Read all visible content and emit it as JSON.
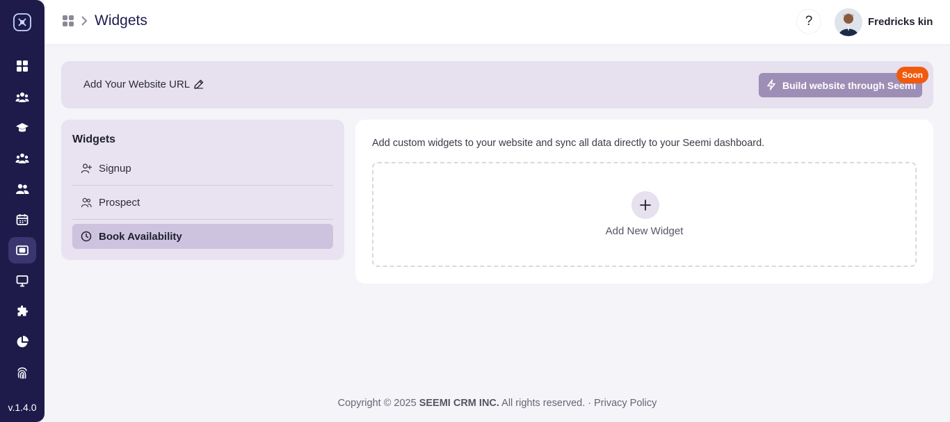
{
  "sidebar": {
    "items": [
      {
        "icon": "dashboard-grid-icon"
      },
      {
        "icon": "team-icon"
      },
      {
        "icon": "graduation-cap-icon"
      },
      {
        "icon": "group-icon"
      },
      {
        "icon": "users-icon"
      },
      {
        "icon": "calendar-icon"
      },
      {
        "icon": "website-widget-icon",
        "active": true
      },
      {
        "icon": "monitor-icon"
      },
      {
        "icon": "puzzle-icon"
      },
      {
        "icon": "pie-chart-icon"
      },
      {
        "icon": "fingerprint-icon"
      }
    ],
    "version": "v.1.4.0"
  },
  "header": {
    "title": "Widgets",
    "help_label": "?",
    "user_name": "Fredricks kin"
  },
  "url_banner": {
    "label": "Add Your Website URL",
    "build_button_label": "Build website through Seemi",
    "soon_badge": "Soon"
  },
  "widgets_panel": {
    "title": "Widgets",
    "items": [
      {
        "label": "Signup",
        "icon": "user-plus-icon"
      },
      {
        "label": "Prospect",
        "icon": "users-icon"
      },
      {
        "label": "Book Availability",
        "icon": "clock-icon",
        "active": true
      }
    ]
  },
  "main": {
    "description": "Add custom widgets to your website and sync all data directly to your Seemi dashboard.",
    "add_widget_label": "Add New Widget"
  },
  "footer": {
    "copyright": "Copyright © 2025 ",
    "company": "SEEMI CRM INC.",
    "rights": " All rights reserved. · ",
    "privacy_link": "Privacy Policy"
  },
  "colors": {
    "sidebar_bg": "#1e1b4b",
    "accent_light": "#e6e0ef",
    "active_item": "#cdc3df",
    "build_button": "#9c8eb5",
    "soon_badge": "#f15a0d"
  }
}
